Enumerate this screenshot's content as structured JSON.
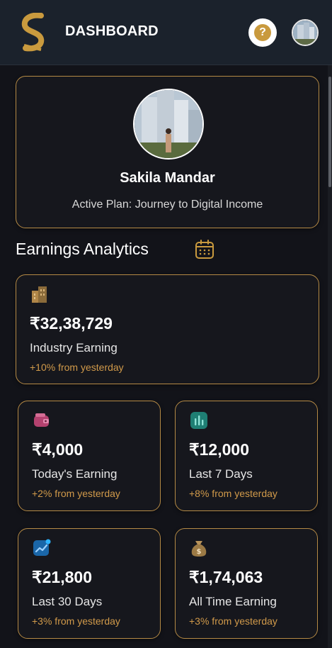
{
  "header": {
    "title": "DASHBOARD",
    "help_symbol": "?",
    "logo_icon": "s-logo-icon",
    "accent": "#c99a3e"
  },
  "profile": {
    "name": "Sakila Mandar",
    "plan": "Active Plan: Journey to Digital Income"
  },
  "analytics": {
    "title": "Earnings Analytics",
    "cards": [
      {
        "icon": "building-icon",
        "amount": "₹32,38,729",
        "label": "Industry Earning",
        "change": "+10% from yesterday"
      },
      {
        "icon": "wallet-icon",
        "amount": "₹4,000",
        "label": "Today's Earning",
        "change": "+2% from yesterday"
      },
      {
        "icon": "bar-chart-icon",
        "amount": "₹12,000",
        "label": "Last 7 Days",
        "change": "+8% from yesterday"
      },
      {
        "icon": "trending-up-icon",
        "amount": "₹21,800",
        "label": "Last 30 Days",
        "change": "+3% from yesterday"
      },
      {
        "icon": "money-bag-icon",
        "amount": "₹1,74,063",
        "label": "All Time Earning",
        "change": "+3% from yesterday"
      }
    ]
  },
  "colors": {
    "card_border": "#b58a46",
    "change_text": "#d19a4a",
    "background": "#121319"
  }
}
